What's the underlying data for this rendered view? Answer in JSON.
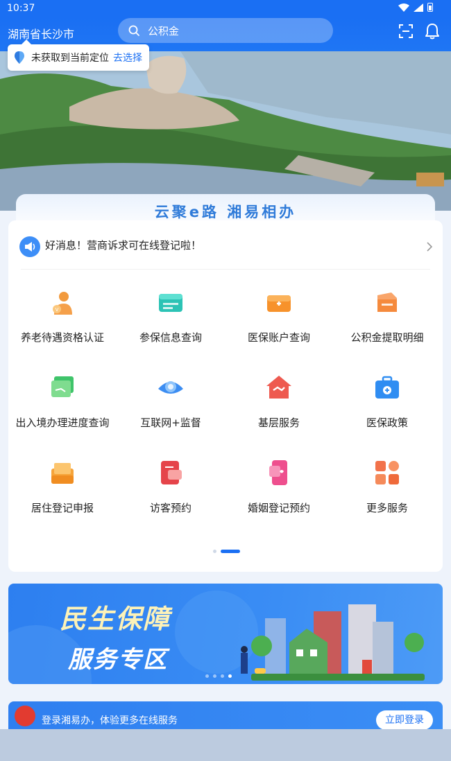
{
  "status": {
    "time": "10:37"
  },
  "header": {
    "city": "湖南省长沙市",
    "search_placeholder": "公积金"
  },
  "location_popup": {
    "message": "未获取到当前定位",
    "action": "去选择"
  },
  "slogan": "云聚e路 湘易相办",
  "notice": {
    "text": "好消息！营商诉求可在线登记啦！"
  },
  "services": [
    {
      "label": "养老待遇资格认证",
      "icon": "pension-worker-icon"
    },
    {
      "label": "参保信息查询",
      "icon": "insurance-card-icon"
    },
    {
      "label": "医保账户查询",
      "icon": "medical-wallet-icon"
    },
    {
      "label": "公积金提取明细",
      "icon": "fund-folder-icon"
    },
    {
      "label": "出入境办理进度查询",
      "icon": "passport-icon"
    },
    {
      "label": "互联网+监督",
      "icon": "eye-icon"
    },
    {
      "label": "基层服务",
      "icon": "house-handshake-icon"
    },
    {
      "label": "医保政策",
      "icon": "medical-kit-icon"
    },
    {
      "label": "居住登记申报",
      "icon": "residence-box-icon"
    },
    {
      "label": "访客预约",
      "icon": "visitor-card-icon"
    },
    {
      "label": "婚姻登记预约",
      "icon": "marriage-phone-icon"
    },
    {
      "label": "更多服务",
      "icon": "grid-more-icon"
    }
  ],
  "banner": {
    "line1": "民生保障",
    "line2": "服务专区"
  },
  "login": {
    "text": "登录湘易办，体验更多在线服务",
    "button": "立即登录"
  },
  "colors": {
    "primary": "#1a6ff3",
    "banner": "#2d7ff0"
  }
}
